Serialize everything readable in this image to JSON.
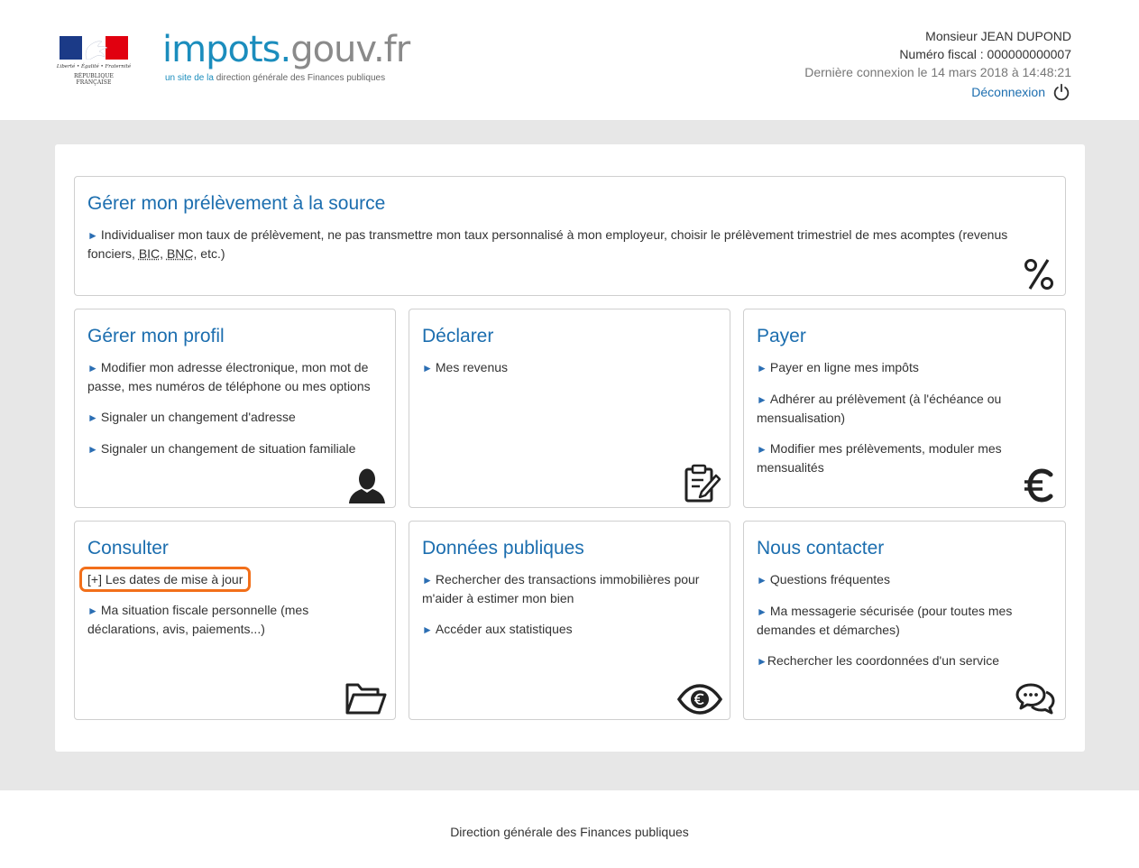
{
  "header": {
    "motto": "Liberté • Égalité • Fraternité",
    "republique": "RÉPUBLIQUE FRANÇAISE",
    "logo_part1": "impots.",
    "logo_part2": "gouv.fr",
    "tagline_part1": "un site de la ",
    "tagline_part2": "direction générale des Finances publiques"
  },
  "user": {
    "name": "Monsieur JEAN DUPOND",
    "tax_number": "Numéro fiscal : 000000000007",
    "last_login": "Dernière connexion le 14 mars 2018 à 14:48:21",
    "logout_label": "Déconnexion"
  },
  "cards": {
    "prelevement": {
      "title": "Gérer mon prélèvement à la source",
      "text_before": "Individualiser mon taux de prélèvement, ne pas transmettre mon taux personnalisé à mon employeur, choisir le prélèvement trimestriel de mes acomptes (revenus fonciers, ",
      "abbr1": "BIC",
      "sep": ", ",
      "abbr2": "BNC",
      "text_after": ", etc.)",
      "icon": "percent-icon"
    },
    "profil": {
      "title": "Gérer mon profil",
      "items": [
        "Modifier mon adresse électronique, mon mot de passe, mes numéros de téléphone ou mes options",
        "Signaler un changement d'adresse",
        "Signaler un changement de situation familiale"
      ],
      "icon": "user-icon"
    },
    "declarer": {
      "title": "Déclarer",
      "items": [
        "Mes revenus"
      ],
      "icon": "clipboard-edit-icon"
    },
    "payer": {
      "title": "Payer",
      "items": [
        "Payer en ligne mes impôts",
        "Adhérer au prélèvement (à l'échéance ou mensualisation)",
        "Modifier mes prélèvements, moduler mes mensualités"
      ],
      "icon": "euro-icon"
    },
    "consulter": {
      "title": "Consulter",
      "toggle": "[+] Les dates de mise à jour",
      "items": [
        "Ma situation fiscale personnelle (mes déclarations, avis, paiements...)"
      ],
      "icon": "folder-icon"
    },
    "donnees": {
      "title": "Données publiques",
      "items": [
        "Rechercher des transactions immobilières pour m'aider à estimer mon bien",
        "Accéder aux statistiques"
      ],
      "icon": "eye-euro-icon"
    },
    "contact": {
      "title": "Nous contacter",
      "items": [
        "Questions fréquentes",
        "Ma messagerie sécurisée (pour toutes mes demandes et démarches)",
        "Rechercher les coordonnées d'un service"
      ],
      "icon": "chat-icon"
    }
  },
  "footer": {
    "text": "Direction générale des Finances publiques"
  },
  "colors": {
    "title_blue": "#1c6eaf",
    "highlight_orange": "#f26f1a",
    "band_gray": "#e7e7e7"
  }
}
